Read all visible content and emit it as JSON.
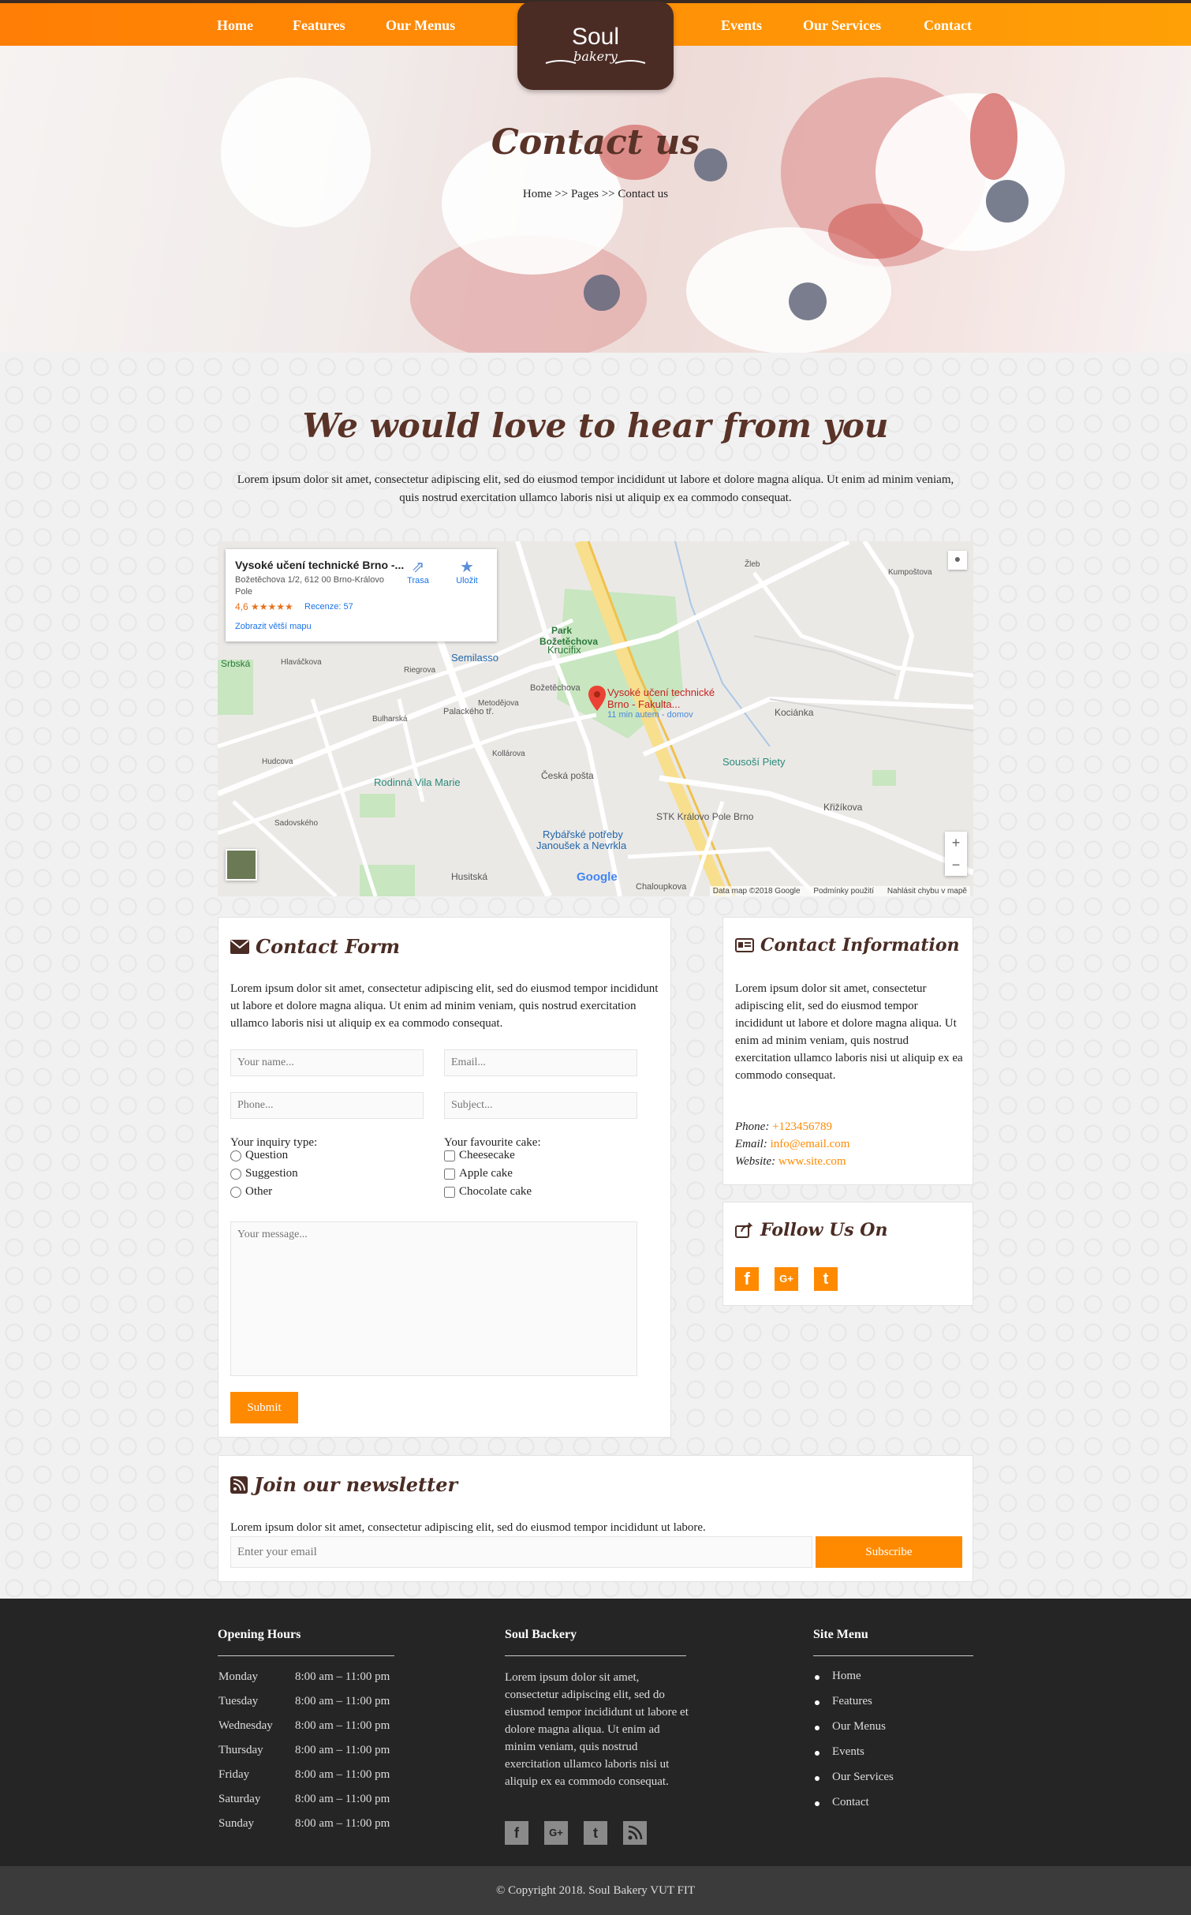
{
  "nav": {
    "left": [
      "Home",
      "Features",
      "Our Menus"
    ],
    "right": [
      "Events",
      "Our Services",
      "Contact"
    ],
    "logo_line1": "Soul",
    "logo_line2": "bakery"
  },
  "hero": {
    "title": "Contact us",
    "breadcrumb": "Home >> Pages >> Contact us"
  },
  "section": {
    "title": "We would love to hear from you",
    "intro": "Lorem ipsum dolor sit amet, consectetur adipiscing elit, sed do eiusmod tempor incididunt ut labore et dolore magna aliqua. Ut enim ad minim veniam, quis nostrud exercitation ullamco laboris nisi ut aliquip ex ea commodo consequat."
  },
  "map": {
    "place_title": "Vysoké učení technické Brno -...",
    "place_address": "Božetěchova 1/2, 612 00 Brno-Královo Pole",
    "rating": "4,6 ★★★★★",
    "reviews": "Recenze: 57",
    "bigger_map_link": "Zobrazit větší mapu",
    "directions_label": "Trasa",
    "save_label": "Uložit",
    "pin_label_line1": "Vysoké učení technické",
    "pin_label_line2": "Brno - Fakulta...",
    "pin_sub": "11 min autem - domov",
    "labels": {
      "park": "Park",
      "park2": "Božetěchova",
      "semilasso": "Semilasso",
      "krucifix": "Krucifix",
      "srbska": "Srbská",
      "rodinna": "Rodinná Vila Marie",
      "posta": "Česká pošta",
      "pieta": "Sousoší Piety",
      "stk": "STK Královo Pole Brno",
      "rybarske1": "Rybářské potřeby",
      "rybarske2": "Janoušek a Nevrkla",
      "kocianka": "Kociánka",
      "krizikova": "Křižíkova",
      "husitska": "Husitská",
      "chaloupkova": "Chaloupkova",
      "bozetechova_street": "Božetěchova",
      "palackeho": "Palackého tř.",
      "zleb": "Žleb",
      "kumpostova": "Kumpoštova",
      "metodejova": "Metodějova",
      "kollarova": "Kollárova",
      "riegrova": "Riegrova",
      "hlavackova": "Hlaváčkova",
      "hudcova": "Hudcova",
      "bulharska": "Bulharská",
      "sadovskeho": "Sadovského"
    },
    "google": "Google",
    "footer_data": "Data map ©2018 Google",
    "footer_terms": "Podmínky použití",
    "footer_report": "Nahlásit chybu v mapě",
    "zoom_in": "+",
    "zoom_out": "−"
  },
  "contact_form": {
    "title": "Contact Form",
    "text": "Lorem ipsum dolor sit amet, consectetur adipiscing elit, sed do eiusmod tempor incididunt ut labore et dolore magna aliqua. Ut enim ad minim veniam, quis nostrud exercitation ullamco laboris nisi ut aliquip ex ea commodo consequat.",
    "name_placeholder": "Your name...",
    "email_placeholder": "Email...",
    "phone_placeholder": "Phone...",
    "subject_placeholder": "Subject...",
    "inquiry_label": "Your inquiry type:",
    "inquiry_options": [
      "Question",
      "Suggestion",
      "Other"
    ],
    "cake_label": "Your favourite cake:",
    "cake_options": [
      "Cheesecake",
      "Apple cake",
      "Chocolate cake"
    ],
    "message_placeholder": "Your message...",
    "submit": "Submit"
  },
  "contact_info": {
    "title": "Contact Information",
    "text": "Lorem ipsum dolor sit amet, consectetur adipiscing elit, sed do eiusmod tempor incididunt ut labore et dolore magna aliqua. Ut enim ad minim veniam, quis nostrud exercitation ullamco laboris nisi ut aliquip ex ea commodo consequat.",
    "phone_label": "Phone:",
    "phone": "+123456789",
    "email_label": "Email:",
    "email": "info@email.com",
    "website_label": "Website:",
    "website": "www.site.com"
  },
  "follow": {
    "title": "Follow Us On",
    "icons": [
      "f",
      "G+",
      "t"
    ]
  },
  "newsletter": {
    "title": "Join our newsletter",
    "text": "Lorem ipsum dolor sit amet, consectetur adipiscing elit, sed do eiusmod tempor incididunt ut labore.",
    "placeholder": "Enter your email",
    "button": "Subscribe"
  },
  "footer": {
    "hours_title": "Opening Hours",
    "hours": [
      {
        "day": "Monday",
        "time": "8:00 am – 11:00 pm"
      },
      {
        "day": "Tuesday",
        "time": "8:00 am – 11:00 pm"
      },
      {
        "day": "Wednesday",
        "time": "8:00 am – 11:00 pm"
      },
      {
        "day": "Thursday",
        "time": "8:00 am – 11:00 pm"
      },
      {
        "day": "Friday",
        "time": "8:00 am – 11:00 pm"
      },
      {
        "day": "Saturday",
        "time": "8:00 am – 11:00 pm"
      },
      {
        "day": "Sunday",
        "time": "8:00 am – 11:00 pm"
      }
    ],
    "about_title": "Soul Backery",
    "about_text": "Lorem ipsum dolor sit amet, consectetur adipiscing elit, sed do eiusmod tempor incididunt ut labore et dolore magna aliqua. Ut enim ad minim veniam, quis nostrud exercitation ullamco laboris nisi ut aliquip ex ea commodo consequat.",
    "social_icons": [
      "f",
      "G+",
      "t",
      "rss"
    ],
    "menu_title": "Site Menu",
    "menu": [
      "Home",
      "Features",
      "Our Menus",
      "Events",
      "Our Services",
      "Contact"
    ],
    "copyright": "© Copyright 2018. Soul Bakery VUT FIT"
  },
  "colors": {
    "accent": "#ff8a00",
    "brown": "#4a2c24",
    "footer_bg": "#252525"
  }
}
